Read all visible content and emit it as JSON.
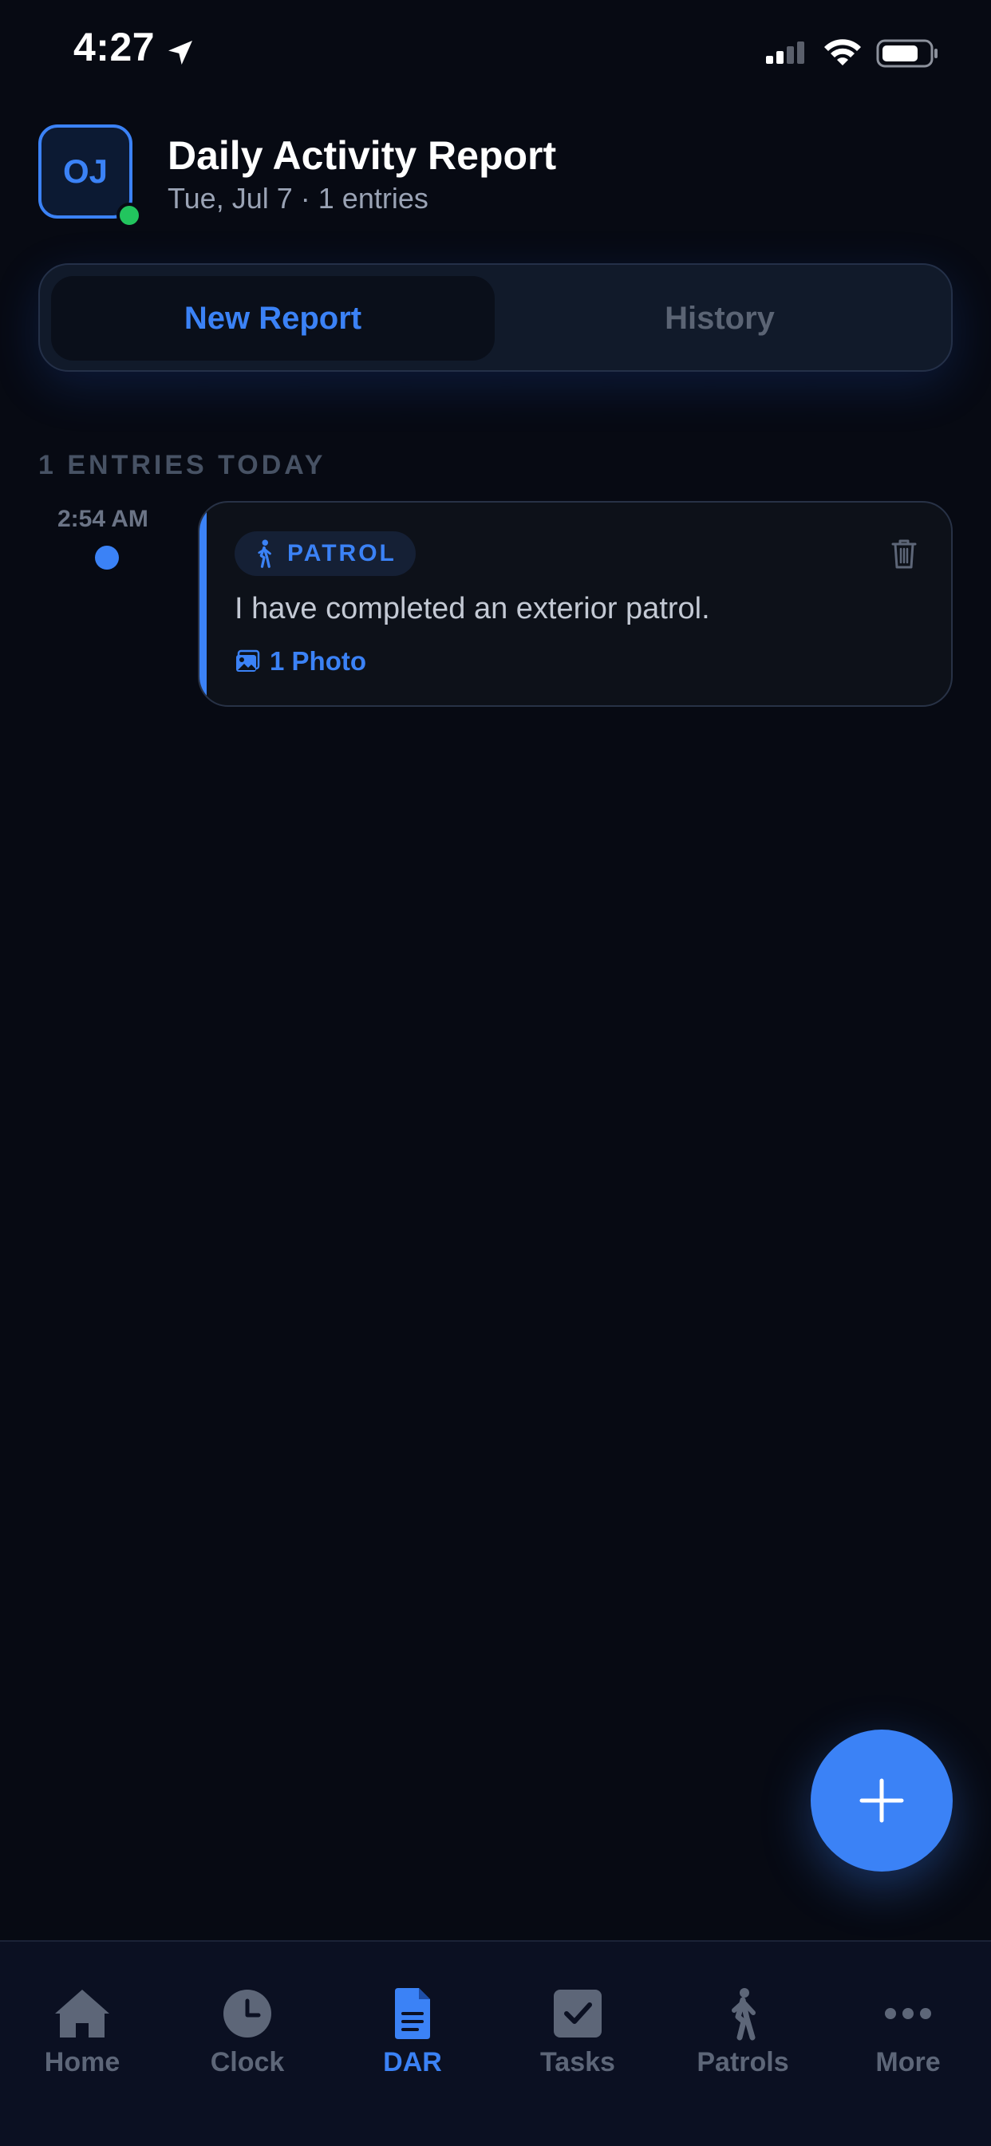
{
  "status_bar": {
    "time": "4:27",
    "icons": [
      "location-arrow-icon",
      "cellular-signal-icon",
      "wifi-icon",
      "battery-icon"
    ]
  },
  "header": {
    "avatar_initials": "OJ",
    "title": "Daily Activity Report",
    "date": "Tue, Jul 7",
    "separator": "·",
    "entry_count_text": "1 entries"
  },
  "segment": {
    "active": "New Report",
    "inactive": "History"
  },
  "section": {
    "label": "1 ENTRIES TODAY"
  },
  "entries": [
    {
      "time": "2:54 AM",
      "badge": "PATROL",
      "badge_icon": "walking-person-icon",
      "text": "I have completed an exterior patrol.",
      "photos": "1 Photo"
    }
  ],
  "fab": {
    "icon": "plus-icon"
  },
  "tabbar": {
    "active": "DAR",
    "items": [
      {
        "label": "Home",
        "icon": "home-icon"
      },
      {
        "label": "Clock",
        "icon": "clock-icon"
      },
      {
        "label": "DAR",
        "icon": "document-icon"
      },
      {
        "label": "Tasks",
        "icon": "checkbox-icon"
      },
      {
        "label": "Patrols",
        "icon": "walking-person-icon"
      },
      {
        "label": "More",
        "icon": "more-dots-icon"
      }
    ]
  },
  "colors": {
    "background": "#070a13",
    "accent": "#3b82f6",
    "online": "#22c55e",
    "muted": "#5d6678"
  }
}
